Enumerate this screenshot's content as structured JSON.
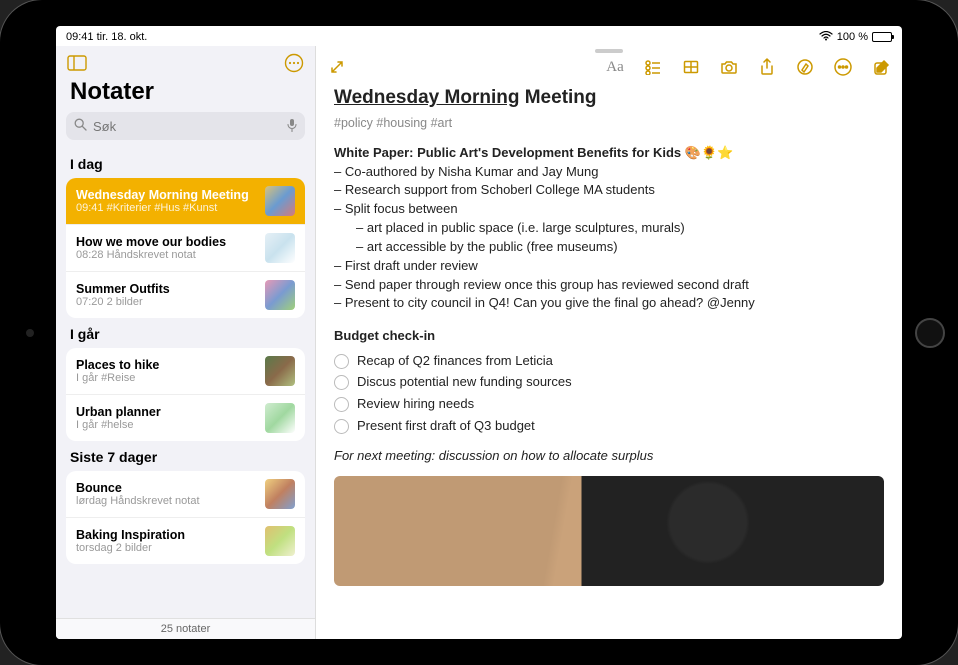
{
  "statusbar": {
    "time_date": "09:41  tir. 18. okt.",
    "battery_label": "100 %"
  },
  "sidebar": {
    "title": "Notater",
    "search_placeholder": "Søk",
    "footer": "25 notater",
    "sections": [
      {
        "header": "I dag",
        "items": [
          {
            "title": "Wednesday Morning Meeting",
            "subtitle": "09:41  #Kriterier #Hus #Kunst",
            "selected": true,
            "thumb_colors": [
              "#d8c27a",
              "#6a9bd1",
              "#d57a7a"
            ]
          },
          {
            "title": "How we move our bodies",
            "subtitle": "08:28  Håndskrevet notat",
            "thumb_colors": [
              "#e6f0f6",
              "#c9e2ee",
              "#fff"
            ]
          },
          {
            "title": "Summer Outfits",
            "subtitle": "07:20  2 bilder",
            "thumb_colors": [
              "#e79ab6",
              "#7a9bd1",
              "#a0d17a"
            ]
          }
        ]
      },
      {
        "header": "I går",
        "items": [
          {
            "title": "Places to hike",
            "subtitle": "I går  #Reise",
            "thumb_colors": [
              "#5a7a4a",
              "#8a6a4a",
              "#b0c080"
            ]
          },
          {
            "title": "Urban planner",
            "subtitle": "I går  #helse",
            "thumb_colors": [
              "#d0ecd0",
              "#a0d8a0",
              "#fff"
            ]
          }
        ]
      },
      {
        "header": "Siste 7 dager",
        "items": [
          {
            "title": "Bounce",
            "subtitle": "lørdag  Håndskrevet notat",
            "thumb_colors": [
              "#f0d080",
              "#c08060",
              "#80a0d0"
            ]
          },
          {
            "title": "Baking Inspiration",
            "subtitle": "torsdag  2 bilder",
            "thumb_colors": [
              "#e0c070",
              "#c0e080",
              "#f0f0d0"
            ]
          }
        ]
      }
    ]
  },
  "note": {
    "title_underlined": "Wednesday Morning",
    "title_rest": " Meeting",
    "tags": "#policy #housing #art",
    "white_paper_heading": "White Paper: Public Art's Development Benefits for Kids 🎨🌻⭐",
    "bullets": [
      "– Co-authored by Nisha Kumar and Jay Mung",
      "– Research support from Schoberl College MA students",
      "– Split focus between"
    ],
    "sub_bullets": [
      "– art placed in public space (i.e. large sculptures, murals)",
      "– art accessible by the public (free museums)"
    ],
    "bullets2": [
      "– First draft under review",
      "– Send paper through review once this group has reviewed second draft",
      "– Present to city council in Q4! Can you give the final go ahead? @Jenny"
    ],
    "budget_heading": "Budget check-in",
    "checklist": [
      "Recap of Q2 finances from Leticia",
      "Discus potential new funding sources",
      "Review hiring needs",
      "Present first draft of Q3 budget"
    ],
    "footer_italic": "For next meeting: discussion on how to allocate surplus"
  }
}
